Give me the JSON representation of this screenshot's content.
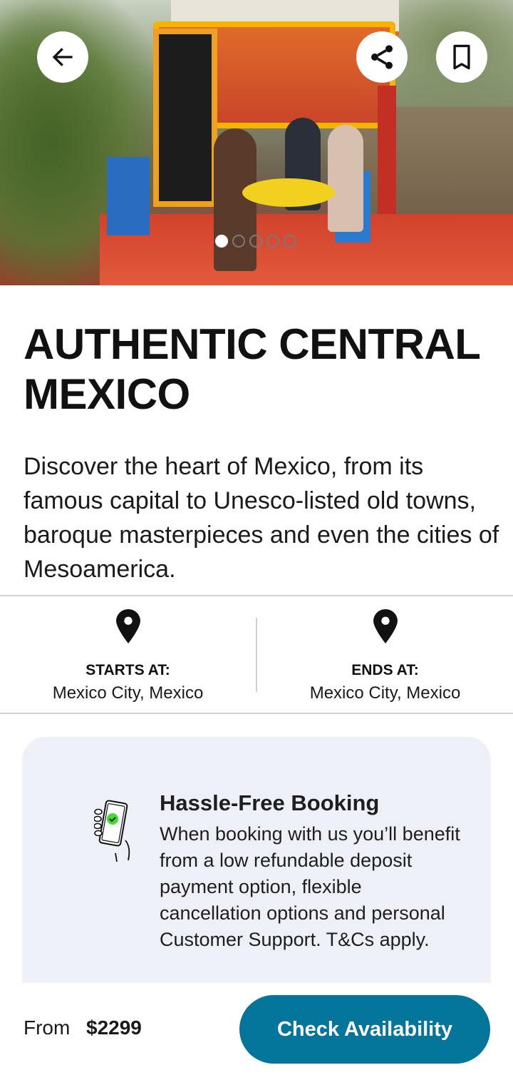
{
  "hero": {
    "image_alt": "Friends sharing drinks on a colorful trajinera boat in Xochimilco",
    "carousel": {
      "total_slides": 5,
      "active_index": 0
    },
    "actions": {
      "back": "back-arrow-icon",
      "share": "share-icon",
      "bookmark": "bookmark-icon"
    }
  },
  "tour": {
    "title": "AUTHENTIC CENTRAL MEXICO",
    "description": "Discover the heart of Mexico, from its famous capital to Unesco-listed old towns, baroque masterpieces and even the cities of Mesoamerica."
  },
  "endpoints": {
    "start": {
      "label": "STARTS AT:",
      "value": "Mexico City, Mexico",
      "icon": "map-pin-icon"
    },
    "end": {
      "label": "ENDS AT:",
      "value": "Mexico City, Mexico",
      "icon": "map-pin-icon"
    }
  },
  "booking_card": {
    "icon": "phone-check-icon",
    "title": "Hassle-Free Booking",
    "text": "When booking with us you’ll benefit from a low refundable deposit payment option, flexible cancellation options and personal Customer Support. T&Cs apply."
  },
  "footer": {
    "from_label": "From",
    "price": "$2299",
    "cta_label": "Check Availability"
  },
  "colors": {
    "accent": "#03759a",
    "card_bg": "#edf1f7",
    "check_green": "#3ddc2e"
  }
}
